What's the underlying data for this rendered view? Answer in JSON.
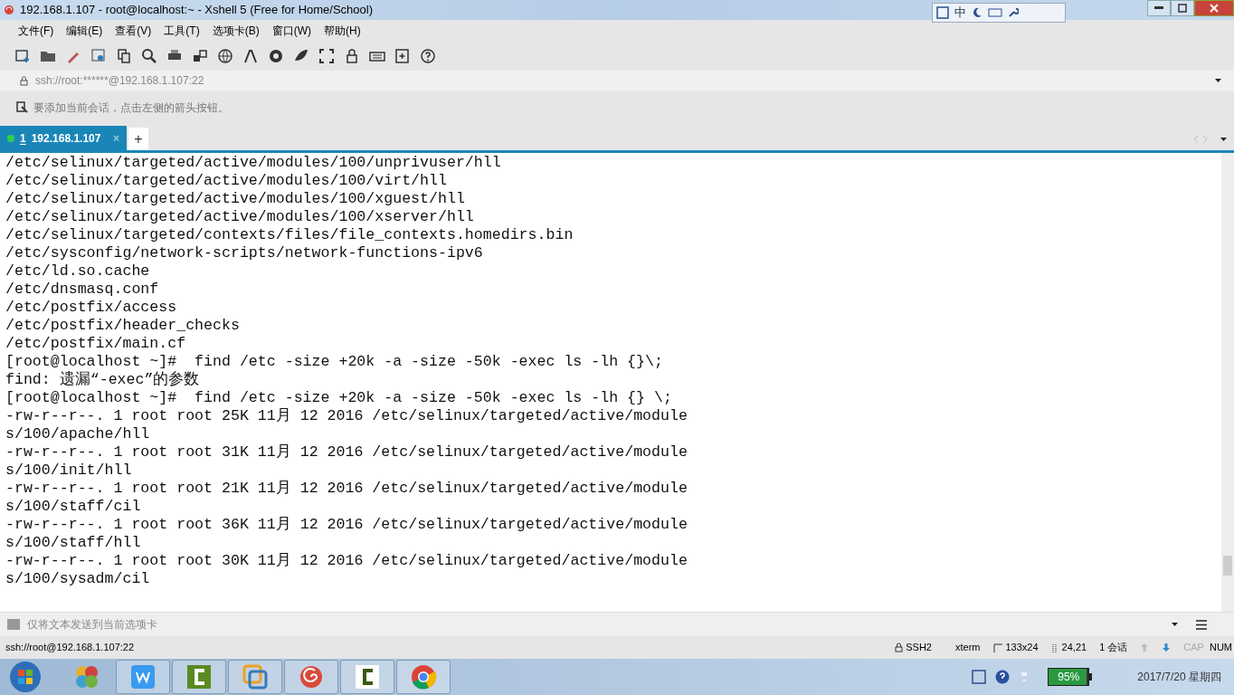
{
  "window": {
    "title": "192.168.1.107 - root@localhost:~ - Xshell 5 (Free for Home/School)"
  },
  "ime_bar": {
    "mode": "中"
  },
  "menu": [
    "文件(F)",
    "编辑(E)",
    "查看(V)",
    "工具(T)",
    "选项卡(B)",
    "窗口(W)",
    "帮助(H)"
  ],
  "address": "ssh://root:******@192.168.1.107:22",
  "session_hint": "要添加当前会话，点击左侧的箭头按钮。",
  "tabs": [
    {
      "number": "1",
      "label": "192.168.1.107",
      "close": "×",
      "selected": true
    }
  ],
  "new_tab": "+",
  "terminal": {
    "lines": [
      "/etc/selinux/targeted/active/modules/100/unprivuser/hll",
      "/etc/selinux/targeted/active/modules/100/virt/hll",
      "/etc/selinux/targeted/active/modules/100/xguest/hll",
      "/etc/selinux/targeted/active/modules/100/xserver/hll",
      "/etc/selinux/targeted/contexts/files/file_contexts.homedirs.bin",
      "/etc/sysconfig/network-scripts/network-functions-ipv6",
      "/etc/ld.so.cache",
      "/etc/dnsmasq.conf",
      "/etc/postfix/access",
      "/etc/postfix/header_checks",
      "/etc/postfix/main.cf",
      "[root@localhost ~]#  find /etc -size +20k -a -size -50k -exec ls -lh {}\\;",
      "find: 遗漏“-exec”的参数",
      "[root@localhost ~]#  find /etc -size +20k -a -size -50k -exec ls -lh {} \\;",
      "-rw-r--r--. 1 root root 25K 11月 12 2016 /etc/selinux/targeted/active/module",
      "s/100/apache/hll",
      "-rw-r--r--. 1 root root 31K 11月 12 2016 /etc/selinux/targeted/active/module",
      "s/100/init/hll",
      "-rw-r--r--. 1 root root 21K 11月 12 2016 /etc/selinux/targeted/active/module",
      "s/100/staff/cil",
      "-rw-r--r--. 1 root root 36K 11月 12 2016 /etc/selinux/targeted/active/module",
      "s/100/staff/hll",
      "-rw-r--r--. 1 root root 30K 11月 12 2016 /etc/selinux/targeted/active/module",
      "s/100/sysadm/cil"
    ]
  },
  "compose_bar": {
    "placeholder": "仅将文本发送到当前选项卡"
  },
  "status_bar": {
    "connection": "ssh://root@192.168.1.107:22",
    "protocol": "SSH2",
    "terminal_type": "xterm",
    "size": "133x24",
    "cursor": "24,21",
    "sessions": "1 会话",
    "caps": "CAP",
    "num": "NUM"
  },
  "taskbar": {
    "battery": {
      "reading": "95%",
      "level": 0.95
    },
    "date": "2017/7/20 星期四"
  }
}
